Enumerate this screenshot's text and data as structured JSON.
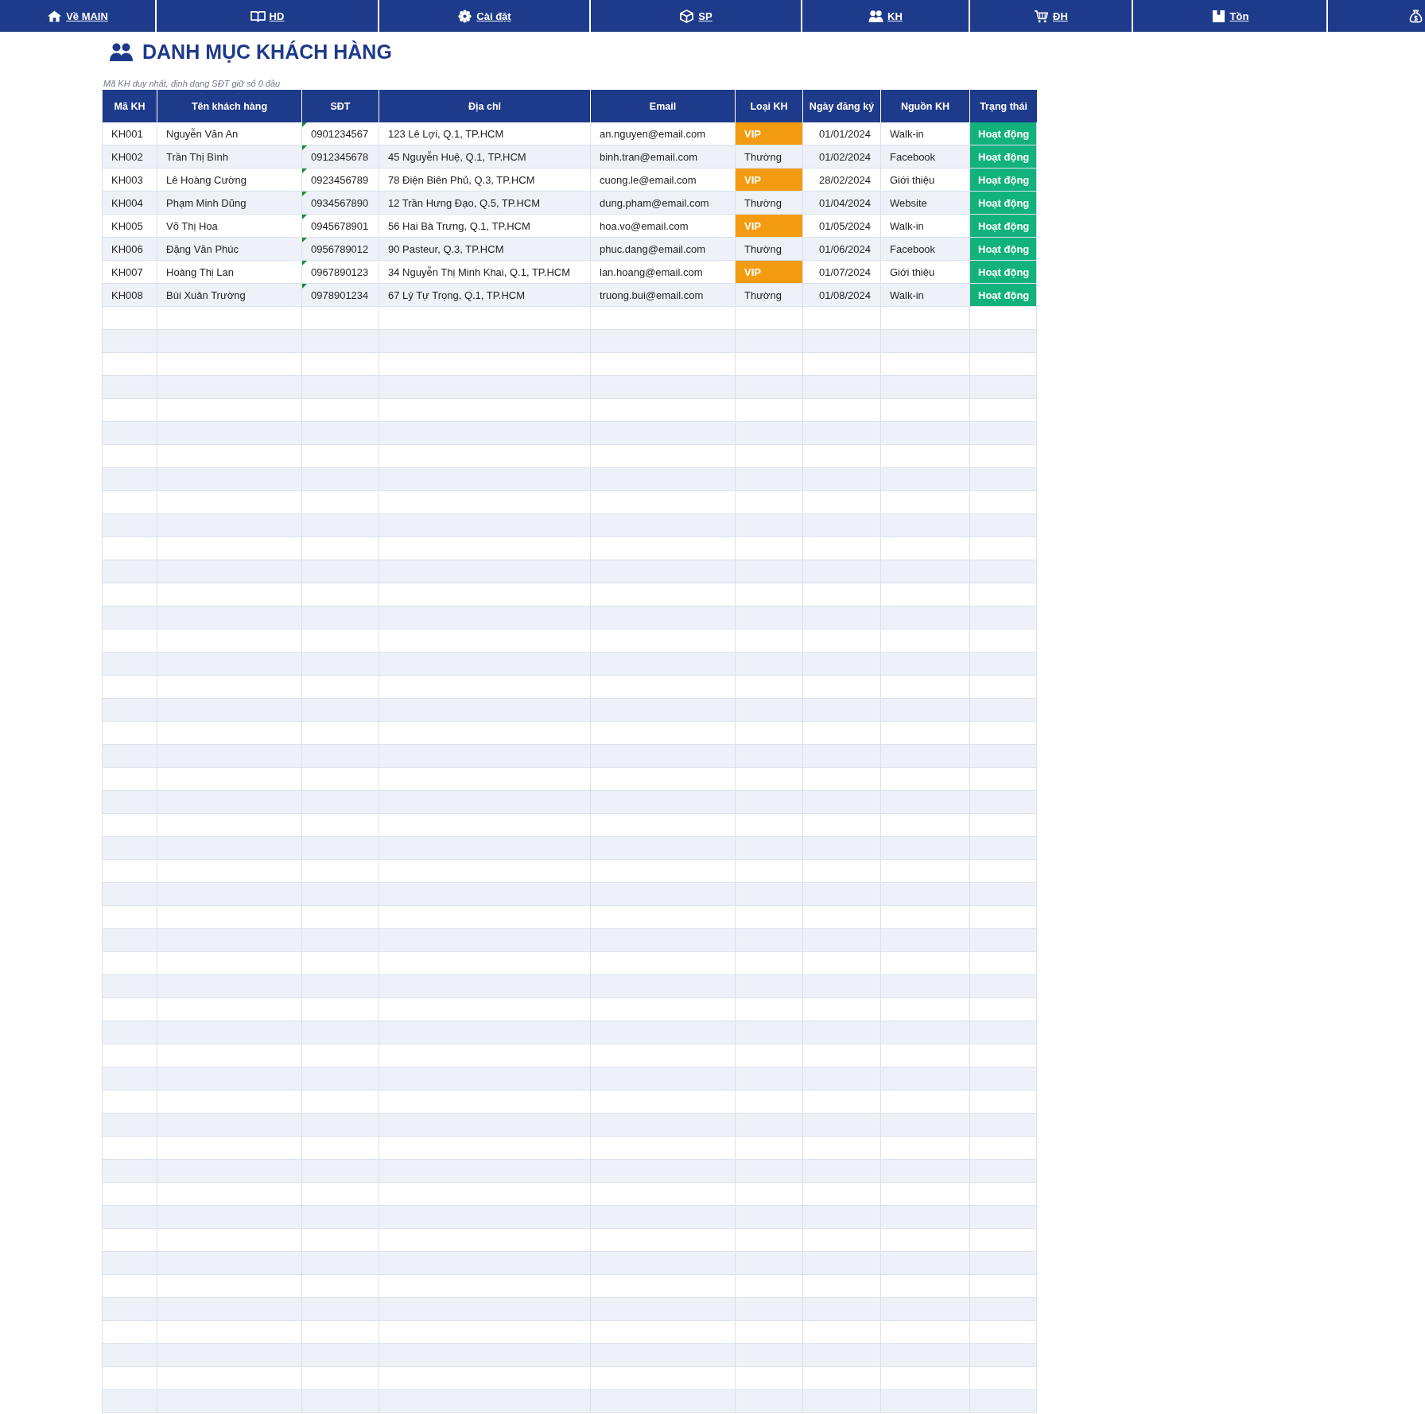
{
  "nav": {
    "links": [
      {
        "label": "Về MAIN"
      },
      {
        "label": "HD"
      },
      {
        "label": "Cài đặt"
      },
      {
        "label": "SP"
      },
      {
        "label": "KH"
      },
      {
        "label": "ĐH"
      },
      {
        "label": "Tồn"
      }
    ]
  },
  "title": "DANH MỤC KHÁCH HÀNG",
  "note": "Mã KH duy nhất, định dạng SĐT giữ số 0 đầu",
  "table": {
    "columns": [
      "Mã KH",
      "Tên khách hàng",
      "SĐT",
      "Địa chỉ",
      "Email",
      "Loại KH",
      "Ngày đăng ký",
      "Nguồn KH",
      "Trạng thái"
    ],
    "rows": [
      {
        "id": "KH001",
        "name": "Nguyễn Văn An",
        "phone": "0901234567",
        "number_as_text": true,
        "address": "123 Lê Lợi, Q.1, TP.HCM",
        "email": "an.nguyen@email.com",
        "type": "VIP",
        "type_highlighted": true,
        "registered": "01/01/2024",
        "source": "Walk-in",
        "status": "Hoạt động",
        "status_active": true
      },
      {
        "id": "KH002",
        "name": "Trần Thị Bình",
        "phone": "0912345678",
        "number_as_text": true,
        "address": "45 Nguyễn Huệ, Q.1, TP.HCM",
        "email": "binh.tran@email.com",
        "type": "Thường",
        "type_highlighted": false,
        "registered": "01/02/2024",
        "source": "Facebook",
        "status": "Hoạt động",
        "status_active": true
      },
      {
        "id": "KH003",
        "name": "Lê Hoàng Cường",
        "phone": "0923456789",
        "number_as_text": true,
        "address": "78 Điện Biên Phủ, Q.3, TP.HCM",
        "email": "cuong.le@email.com",
        "type": "VIP",
        "type_highlighted": true,
        "registered": "28/02/2024",
        "source": "Giới thiệu",
        "status": "Hoạt động",
        "status_active": true
      },
      {
        "id": "KH004",
        "name": "Phạm Minh Dũng",
        "phone": "0934567890",
        "number_as_text": true,
        "address": "12 Trần Hưng Đạo, Q.5, TP.HCM",
        "email": "dung.pham@email.com",
        "type": "Thường",
        "type_highlighted": false,
        "registered": "01/04/2024",
        "source": "Website",
        "status": "Hoạt động",
        "status_active": true
      },
      {
        "id": "KH005",
        "name": "Võ Thị Hoa",
        "phone": "0945678901",
        "number_as_text": true,
        "address": "56 Hai Bà Trưng, Q.1, TP.HCM",
        "email": "hoa.vo@email.com",
        "type": "VIP",
        "type_highlighted": true,
        "registered": "01/05/2024",
        "source": "Walk-in",
        "status": "Hoạt động",
        "status_active": true
      },
      {
        "id": "KH006",
        "name": "Đặng Văn Phúc",
        "phone": "0956789012",
        "number_as_text": true,
        "address": "90 Pasteur, Q.3, TP.HCM",
        "email": "phuc.dang@email.com",
        "type": "Thường",
        "type_highlighted": false,
        "registered": "01/06/2024",
        "source": "Facebook",
        "status": "Hoạt động",
        "status_active": true
      },
      {
        "id": "KH007",
        "name": "Hoàng Thị Lan",
        "phone": "0967890123",
        "number_as_text": true,
        "address": "34 Nguyễn Thị Minh Khai, Q.1, TP.HCM",
        "email": "lan.hoang@email.com",
        "type": "VIP",
        "type_highlighted": true,
        "registered": "01/07/2024",
        "source": "Giới thiệu",
        "status": "Hoạt động",
        "status_active": true
      },
      {
        "id": "KH008",
        "name": "Bùi Xuân Trường",
        "phone": "0978901234",
        "number_as_text": true,
        "address": "67 Lý Tự Trọng, Q.1, TP.HCM",
        "email": "truong.bui@email.com",
        "type": "Thường",
        "type_highlighted": false,
        "registered": "01/08/2024",
        "source": "Walk-in",
        "status": "Hoạt động",
        "status_active": true
      }
    ]
  }
}
